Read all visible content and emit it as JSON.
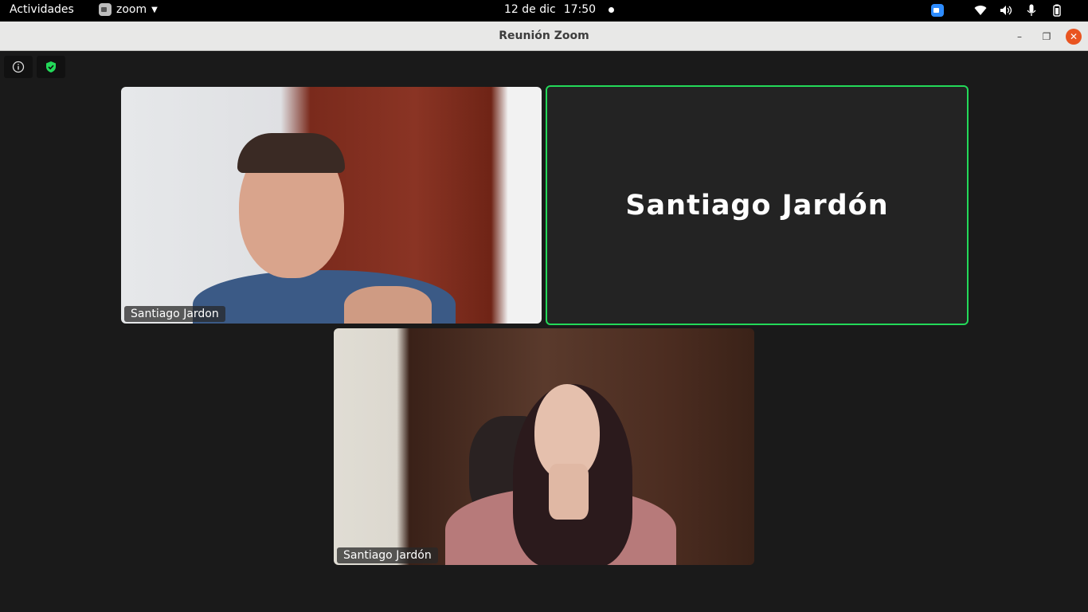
{
  "topbar": {
    "activities": "Actividades",
    "app_name": "zoom",
    "date": "12 de dic",
    "time": "17:50"
  },
  "window": {
    "title": "Reunión Zoom",
    "minimize_label": "–",
    "maximize_label": "❐",
    "close_label": "✕"
  },
  "participants": [
    {
      "name_tag": "Santiago Jardon",
      "video": true
    },
    {
      "name": "Santiago Jardón",
      "video": false,
      "active_speaker": true
    },
    {
      "name_tag": "Santiago Jardón",
      "video": true
    }
  ],
  "colors": {
    "active_speaker_border": "#23d959",
    "close_button": "#e95420",
    "zoom_brand": "#2d8cff"
  },
  "icons": {
    "info": "info-icon",
    "security": "shield-check-icon"
  }
}
